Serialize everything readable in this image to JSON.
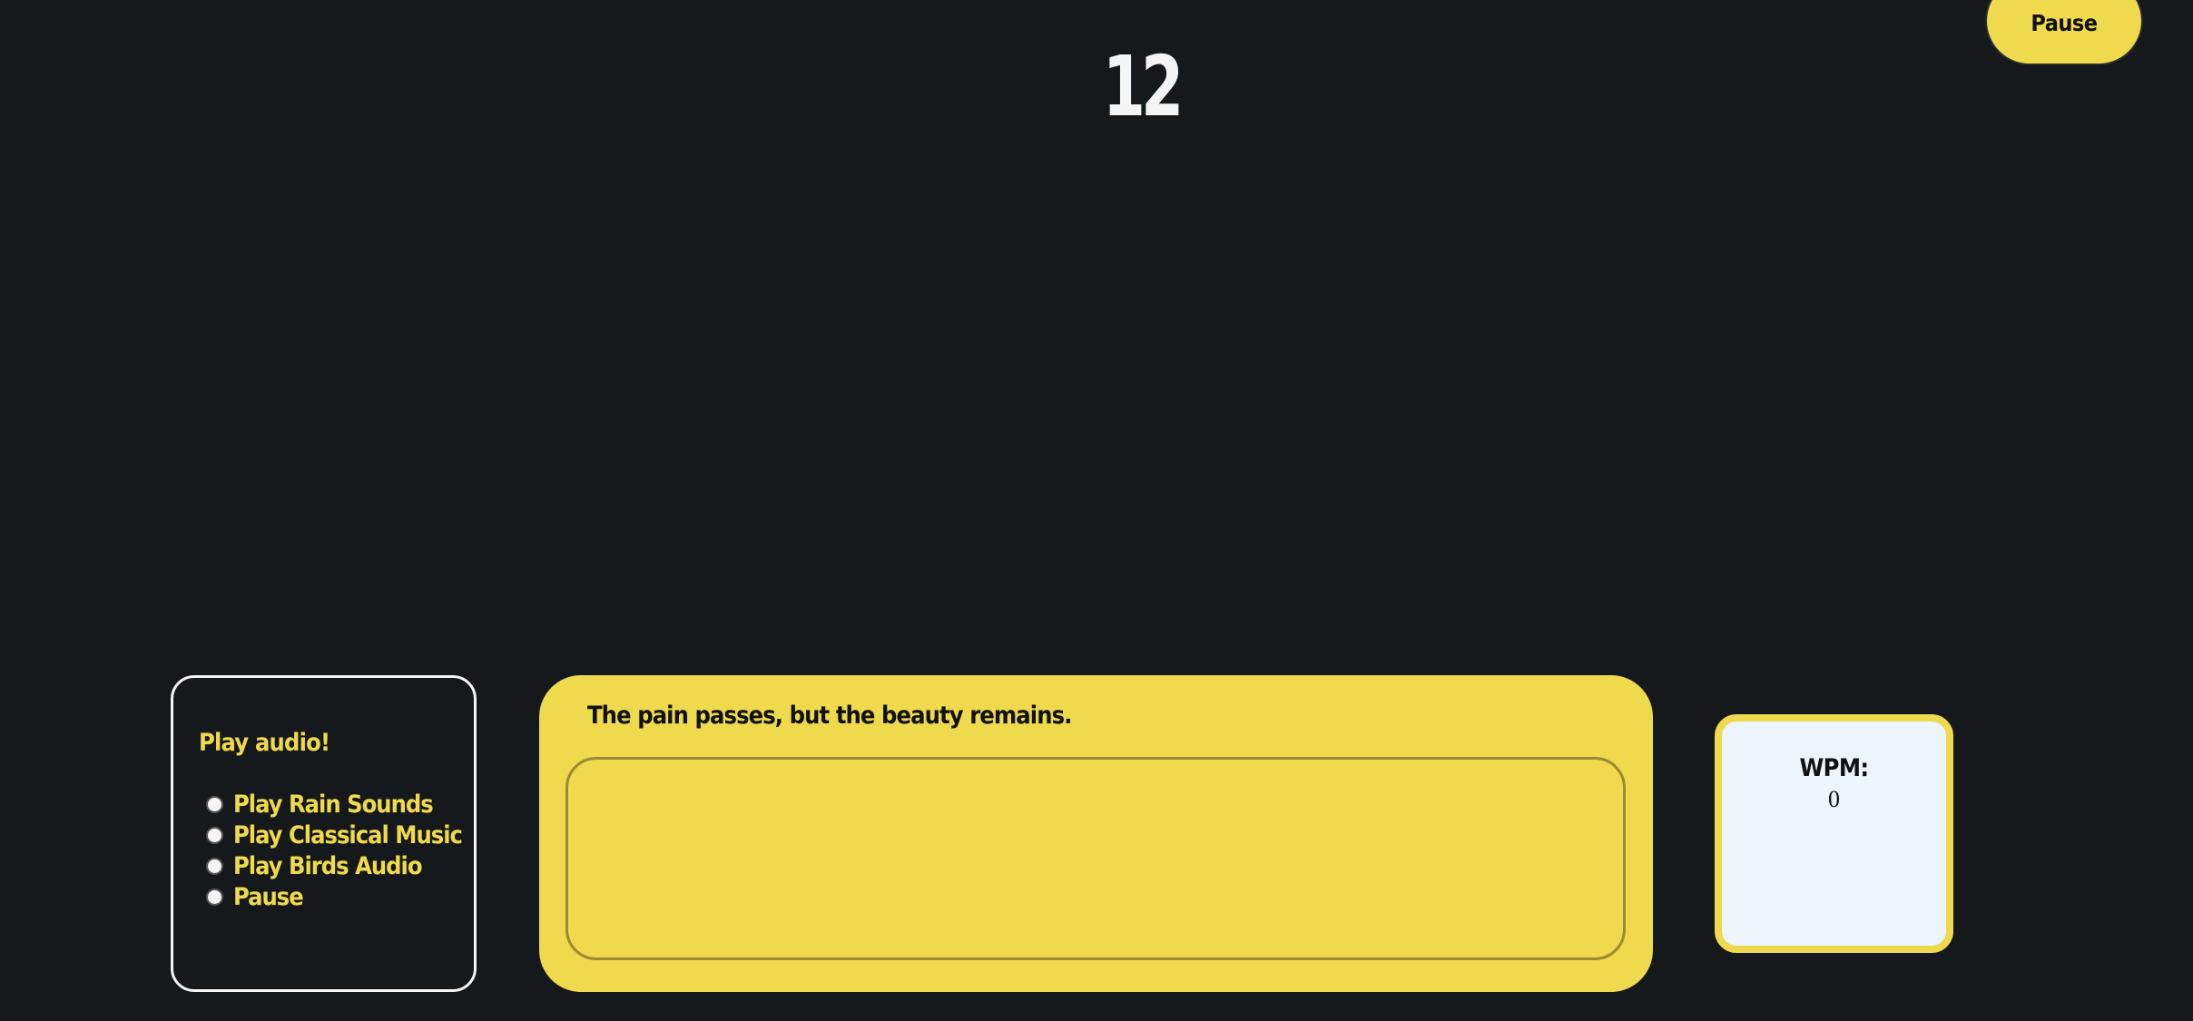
{
  "header": {
    "pause_label": "Pause",
    "timer_value": "12"
  },
  "audio": {
    "title": "Play audio!",
    "options": [
      "Play Rain Sounds",
      "Play Classical Music",
      "Play Birds Audio",
      "Pause"
    ]
  },
  "typing": {
    "quote": "The pain passes, but the beauty remains.",
    "input_value": ""
  },
  "stats": {
    "wpm_label": "WPM:",
    "wpm_value": "0"
  },
  "colors": {
    "background": "#16191b",
    "accent": "#efd94d",
    "panel_light": "#ecf4fc"
  }
}
